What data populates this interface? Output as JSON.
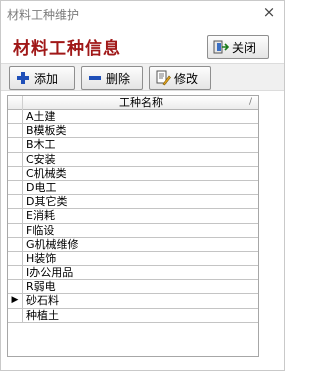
{
  "window": {
    "title": "材料工种维护",
    "close_glyph": "×"
  },
  "header": {
    "heading": "材料工种信息",
    "close_label": "关闭"
  },
  "toolbar": {
    "add_label": "添加",
    "delete_label": "删除",
    "edit_label": "修改"
  },
  "grid": {
    "column_header": "工种名称",
    "sort_mark": "/",
    "selected_indicator": "▶",
    "rows": [
      "A土建",
      "B模板类",
      "B木工",
      "C安装",
      "C机械类",
      "D电工",
      "D其它类",
      "E消耗",
      "F临设",
      "G机械维修",
      "H装饰",
      "I办公用品",
      "R弱电",
      "砂石料",
      "种植土"
    ],
    "selected_index": 13
  },
  "colors": {
    "heading": "#a01818",
    "add_icon": "#1f4fb8",
    "delete_icon": "#1f4fb8"
  }
}
